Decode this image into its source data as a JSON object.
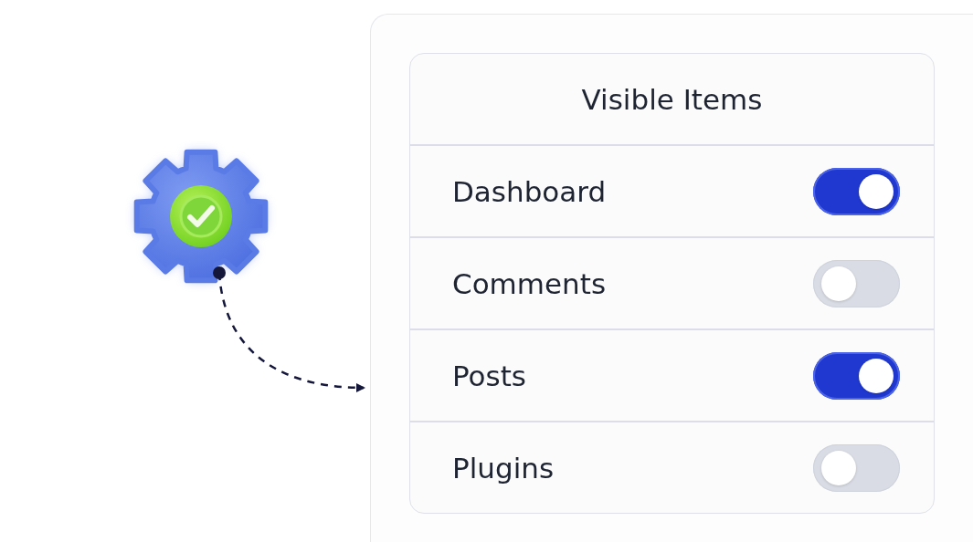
{
  "panel": {
    "title": "Visible Items",
    "items": [
      {
        "label": "Dashboard",
        "on": true
      },
      {
        "label": "Comments",
        "on": false
      },
      {
        "label": "Posts",
        "on": true
      },
      {
        "label": "Plugins",
        "on": false
      }
    ]
  }
}
